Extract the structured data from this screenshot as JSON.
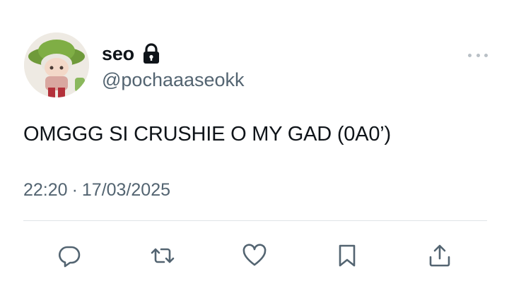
{
  "tweet": {
    "author": {
      "display_name": "seo",
      "handle": "@pochaaaseokk",
      "protected_icon": "lock-icon",
      "avatar": "avatar-figurine-green-hat"
    },
    "text": "OMGGG SI CRUSHIE O MY GAD (0A0’)",
    "time": "22:20",
    "separator": "·",
    "date": "17/03/2025"
  },
  "actions": {
    "reply_icon": "reply-icon",
    "retweet_icon": "retweet-icon",
    "like_icon": "heart-icon",
    "bookmark_icon": "bookmark-icon",
    "share_icon": "share-icon",
    "more_icon": "more-icon"
  },
  "colors": {
    "text_primary": "#0f1419",
    "text_secondary": "#536471",
    "divider": "#dfe3e7",
    "icon": "#536471"
  }
}
